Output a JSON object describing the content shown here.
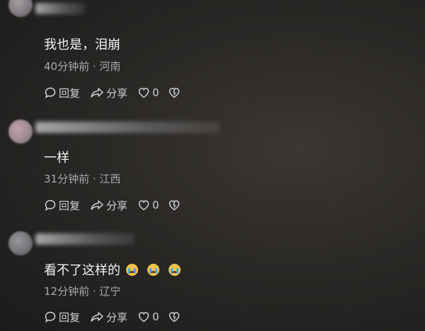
{
  "comments": [
    {
      "text": "我也是，泪崩",
      "time": "40分钟前",
      "location": "河南",
      "reply_label": "回复",
      "share_label": "分享",
      "like_count": "0",
      "emojis": []
    },
    {
      "text": "一样",
      "time": "31分钟前",
      "location": "江西",
      "reply_label": "回复",
      "share_label": "分享",
      "like_count": "0",
      "emojis": []
    },
    {
      "text": "看不了这样的",
      "time": "12分钟前",
      "location": "辽宁",
      "reply_label": "回复",
      "share_label": "分享",
      "like_count": "0",
      "emojis": [
        "crying-face-icon",
        "crying-face-icon",
        "crying-face-icon"
      ]
    }
  ],
  "meta_separator": " · "
}
